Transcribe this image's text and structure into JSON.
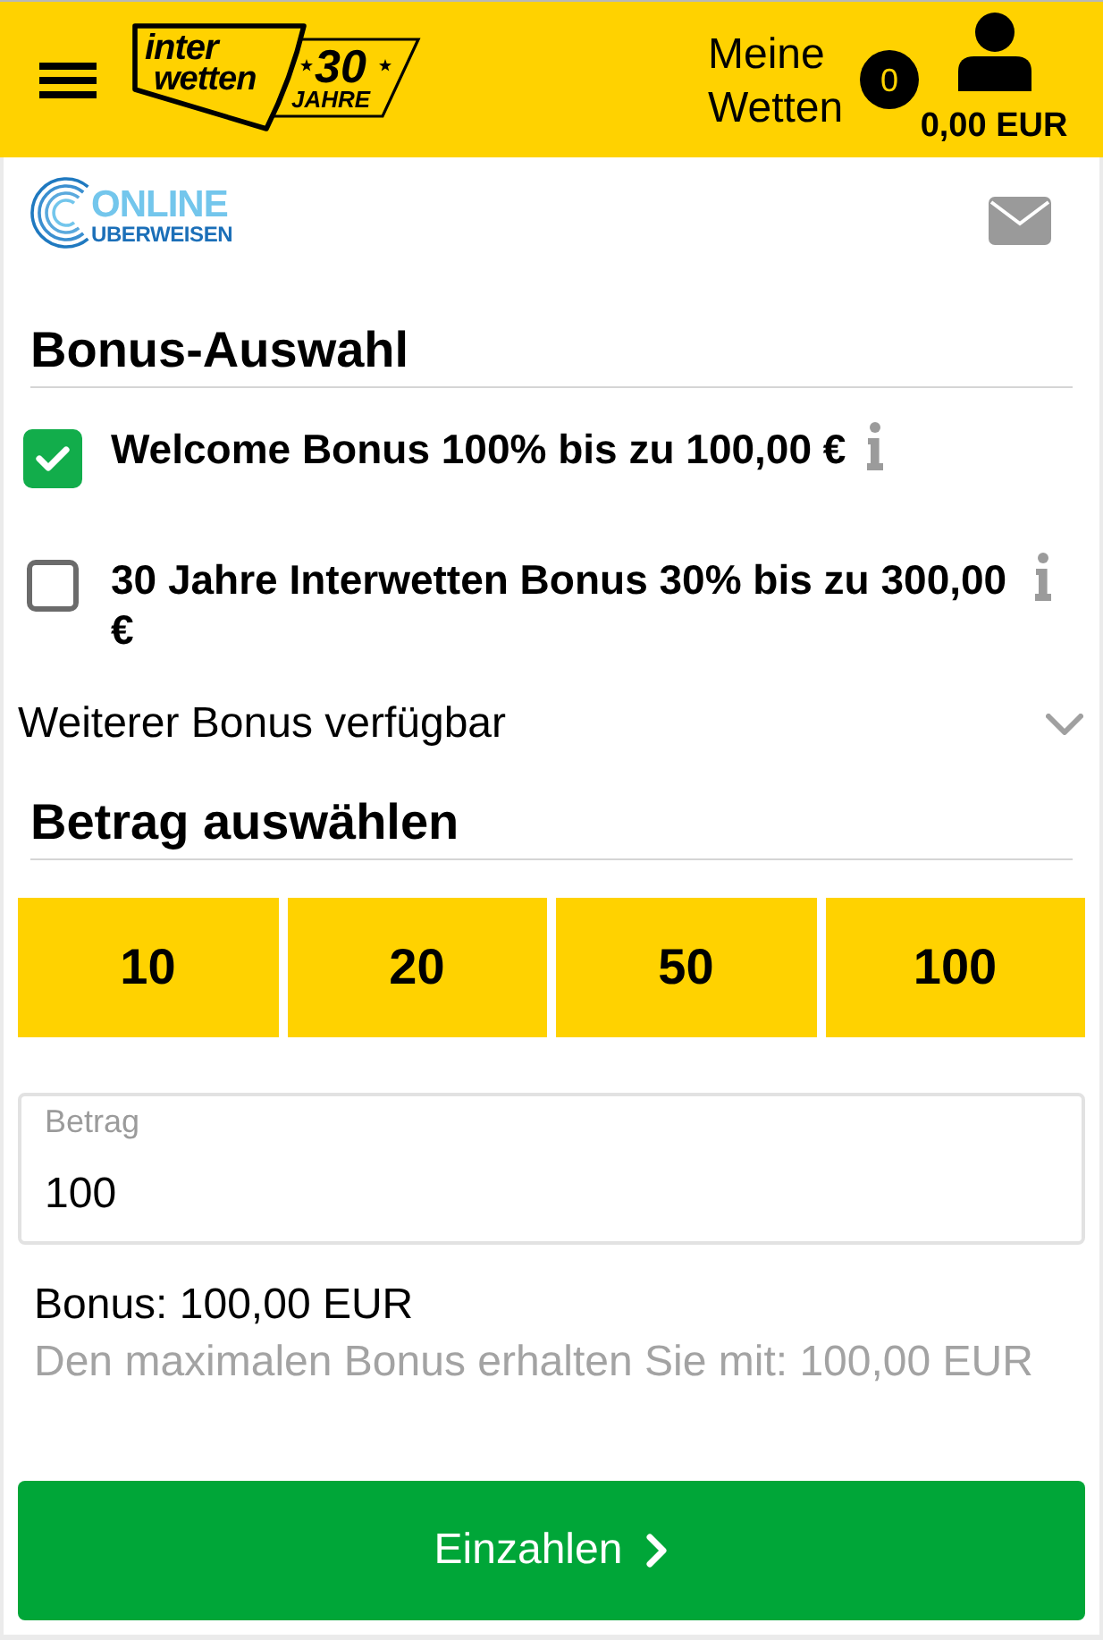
{
  "header": {
    "brand": {
      "line_1": "inter",
      "line_2": "wetten",
      "anniversary_number": "30",
      "anniversary_label": "JAHRE"
    },
    "my_bets": {
      "label": "Meine Wetten",
      "count": "0"
    },
    "account": {
      "balance": "0,00 EUR"
    }
  },
  "payment_method": {
    "logo_line_1": "ONLINE",
    "logo_line_2": "UBERWEISEN"
  },
  "bonus_selection": {
    "title": "Bonus-Auswahl",
    "options": [
      {
        "label": "Welcome Bonus 100% bis zu 100,00 €",
        "checked": true
      },
      {
        "label": "30 Jahre Interwetten Bonus 30% bis zu 300,00 €",
        "checked": false
      }
    ],
    "more_bonus": {
      "label": "Weiterer Bonus verfügbar",
      "expanded": false
    }
  },
  "amount_selection": {
    "title": "Betrag auswählen",
    "presets": [
      "10",
      "20",
      "50",
      "100"
    ],
    "input": {
      "label": "Betrag",
      "value": "100"
    }
  },
  "bonus_summary": {
    "bonus": "Bonus: 100,00 EUR",
    "hint": "Den maximalen Bonus erhalten Sie mit: 100,00 EUR"
  },
  "submit_button": {
    "label": "Einzahlen"
  }
}
